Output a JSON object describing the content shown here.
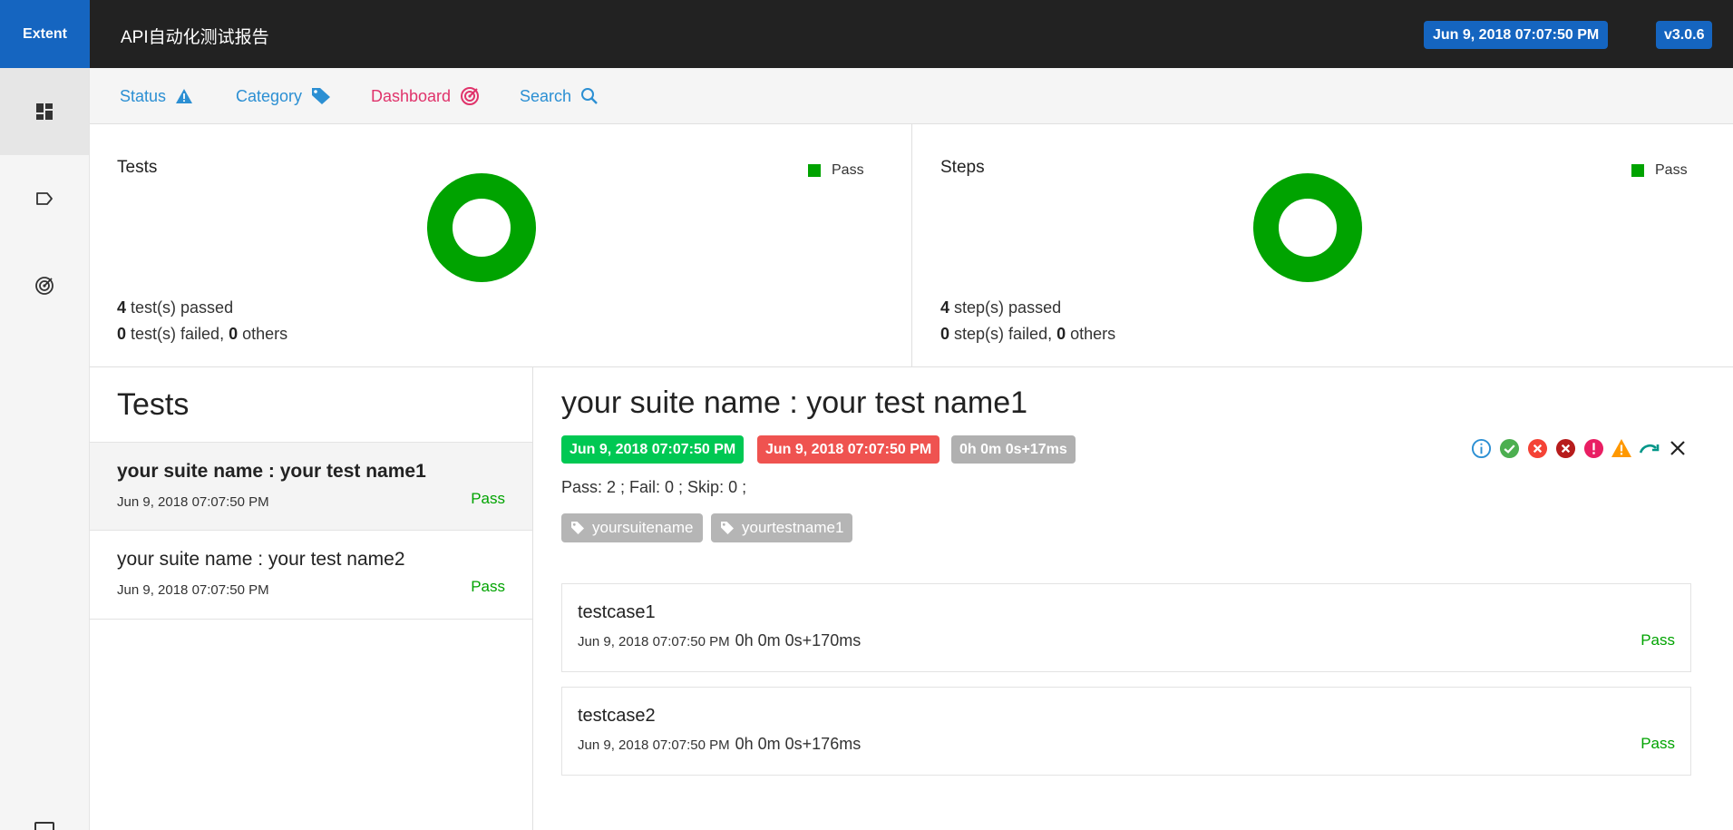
{
  "header": {
    "brand": "Extent",
    "title": "API自动化测试报告",
    "date": "Jun 9, 2018 07:07:50 PM",
    "version": "v3.0.6"
  },
  "sidebar": {
    "items": [
      {
        "icon": "dashboard-icon"
      },
      {
        "icon": "tag-icon"
      },
      {
        "icon": "radar-icon"
      },
      {
        "icon": "monitor-icon"
      }
    ]
  },
  "nav": {
    "status": "Status",
    "category": "Category",
    "dashboard": "Dashboard",
    "search": "Search"
  },
  "summary": {
    "tests": {
      "title": "Tests",
      "legend": "Pass",
      "passed_count": "4",
      "passed_label": "test(s) passed",
      "failed_count": "0",
      "failed_label": "test(s) failed,",
      "others_count": "0",
      "others_label": "others"
    },
    "steps": {
      "title": "Steps",
      "legend": "Pass",
      "passed_count": "4",
      "passed_label": "step(s) passed",
      "failed_count": "0",
      "failed_label": "step(s) failed,",
      "others_count": "0",
      "others_label": "others"
    }
  },
  "test_list": {
    "heading": "Tests",
    "items": [
      {
        "name": "your suite name : your test name1",
        "time": "Jun 9, 2018 07:07:50 PM",
        "status": "Pass"
      },
      {
        "name": "your suite name : your test name2",
        "time": "Jun 9, 2018 07:07:50 PM",
        "status": "Pass"
      }
    ]
  },
  "detail": {
    "title": "your suite name : your test name1",
    "start": "Jun 9, 2018 07:07:50 PM",
    "end": "Jun 9, 2018 07:07:50 PM",
    "duration": "0h 0m 0s+17ms",
    "counts": "Pass: 2 ; Fail: 0 ; Skip: 0 ;",
    "tags": [
      "yoursuitename",
      "yourtestname1"
    ],
    "nodes": [
      {
        "name": "testcase1",
        "time": "Jun 9, 2018 07:07:50 PM",
        "duration": "0h 0m 0s+170ms",
        "status": "Pass"
      },
      {
        "name": "testcase2",
        "time": "Jun 9, 2018 07:07:50 PM",
        "duration": "0h 0m 0s+176ms",
        "status": "Pass"
      }
    ]
  },
  "colors": {
    "pass": "#00a300",
    "accent": "#1565c0",
    "header": "#222222",
    "dashboard": "#e0336b",
    "link": "#2b8fd3"
  }
}
